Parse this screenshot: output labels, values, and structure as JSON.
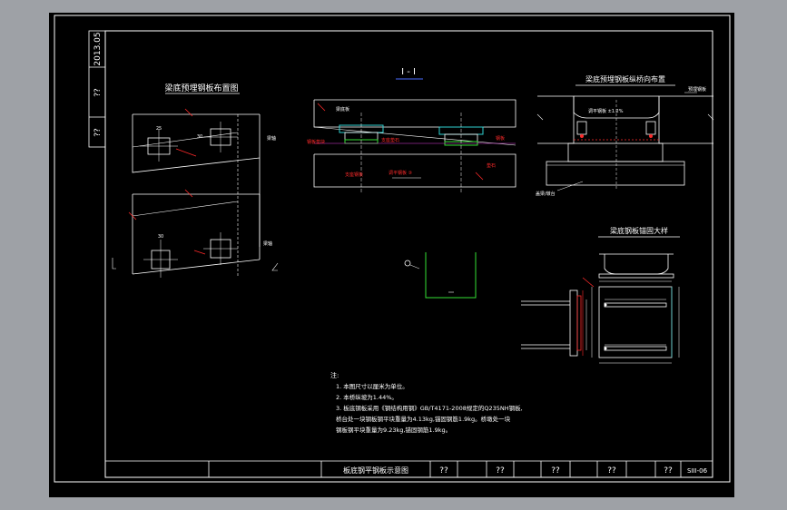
{
  "drawing": {
    "side_block": {
      "date": "2013.05",
      "cell2": "??",
      "cell3": "??"
    },
    "view_titles": {
      "plan": "梁底预埋钢板布置图",
      "section": "I - I",
      "longitudinal": "梁底预埋钢板纵桥向布置",
      "detail": "梁底钢板锚固大样"
    },
    "plan_labels": {
      "dim_left": "25",
      "dim_right": "30",
      "tag_top": "梁轴",
      "dim_bottom_left": "30",
      "tag_bottom": "梁轴"
    },
    "section_labels": {
      "label_top": "梁底板",
      "label_left": "钢板垫块",
      "label_mid": "支座垫石",
      "label_right_top": "钢板",
      "label_right": "垫石",
      "label_bottom_left": "支座钢板",
      "label_bottom_mid": "调平钢板 ③"
    },
    "longitudinal_labels": {
      "label_right": "预埋钢板",
      "label_mid": "调平钢板 ±1.2%",
      "label_bottom": "盖梁/墩台"
    },
    "notes": {
      "heading": "注:",
      "lines": [
        "1. 本图尺寸以厘米为单位。",
        "2. 本桥纵坡为1.44%。",
        "3. 板底钢板采用《钢结构用钢》GB/T4171-2008规定的Q235NH钢板,",
        "   桥台处一块钢板钢平块重量为4.13kg,锚固钢筋1.9kg。桥墩处一块",
        "   钢板钢平块重量为9.23kg,锚固钢筋1.9kg。"
      ]
    },
    "title_block": {
      "drawing_title": "板底钢平钢板示意图",
      "cells": [
        "??",
        "??",
        "??",
        "??",
        "??"
      ],
      "sheet_no": "SIII-06"
    }
  },
  "colors": {
    "background": "#9ea1a6",
    "paper": "#000000",
    "line": "#ffffff",
    "accent_red": "#ff2a2a",
    "accent_green": "#34e034",
    "accent_magenta": "#e040e0",
    "accent_cyan": "#30d0d0",
    "accent_blue": "#4a6cff"
  }
}
